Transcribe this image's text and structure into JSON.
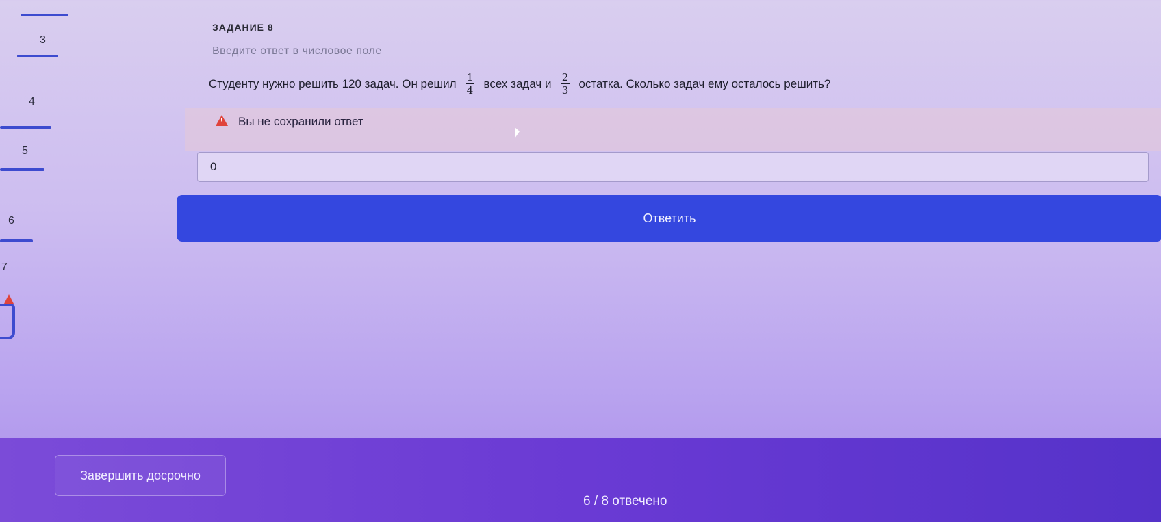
{
  "sidebar": {
    "steps": [
      {
        "num": "3",
        "label": "3"
      },
      {
        "num": "4",
        "label": "4"
      },
      {
        "num": "5",
        "label": "5"
      },
      {
        "num": "6",
        "label": "6"
      },
      {
        "num": "7",
        "label": "7"
      }
    ],
    "flag_icon": "warning-flag-icon"
  },
  "task": {
    "label": "ЗАДАНИЕ 8",
    "hint": "Введите ответ в числовое поле",
    "question_part1": "Студенту нужно решить 120 задач. Он решил",
    "frac1_num": "1",
    "frac1_den": "4",
    "question_part2": "всех задач и",
    "frac2_num": "2",
    "frac2_den": "3",
    "question_part3": "остатка. Сколько задач ему осталось решить?"
  },
  "warning": {
    "icon": "warning-triangle-icon",
    "text": "Вы не сохранили ответ"
  },
  "answer": {
    "value": "0"
  },
  "submit": {
    "label": "Ответить"
  },
  "footer": {
    "finish_label": "Завершить досрочно",
    "progress_text": "6 / 8 отвечено"
  },
  "colors": {
    "accent": "#3447df",
    "warning": "#e0433b",
    "footer": "#6a3ad4"
  }
}
